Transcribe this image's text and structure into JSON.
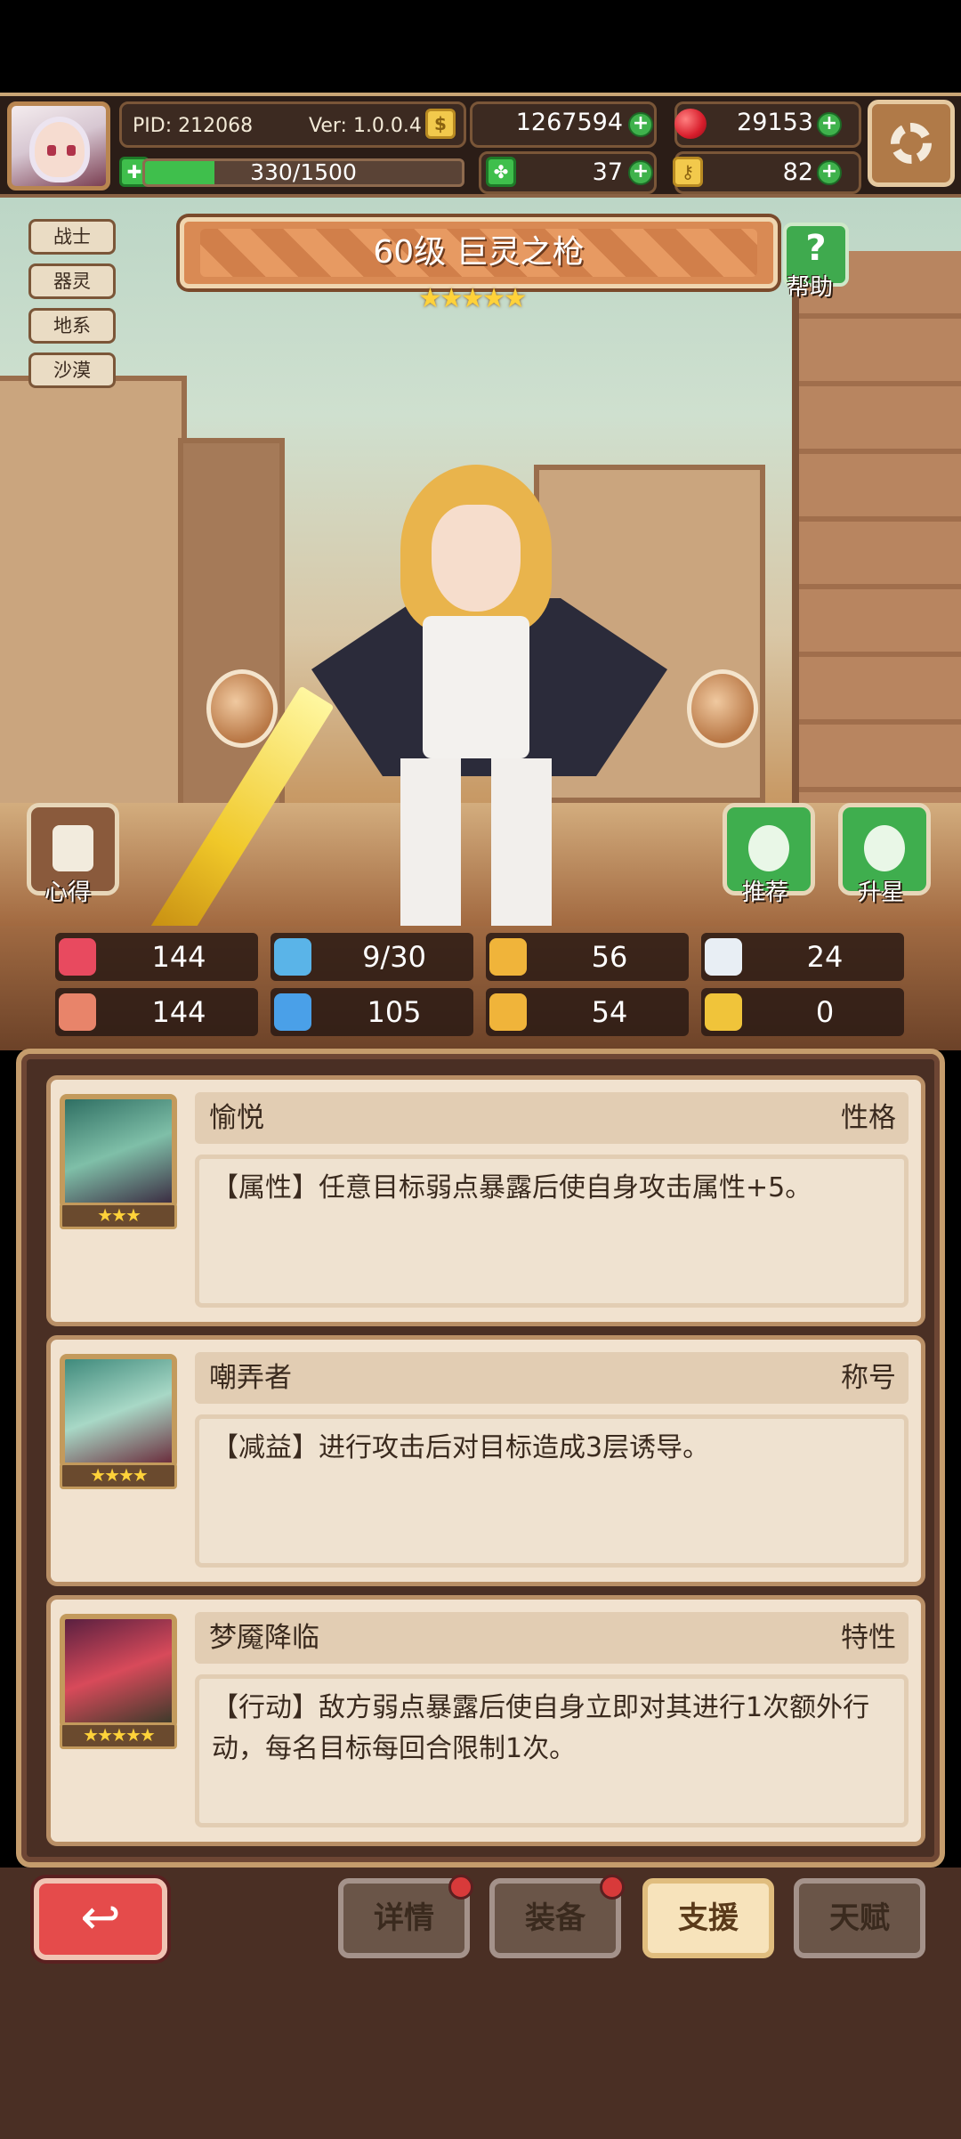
{
  "header": {
    "pid": "PID: 212068",
    "version": "Ver: 1.0.0.4",
    "gold": "1267594",
    "gems": "29153",
    "energy": "330/1500",
    "energy_fraction": 0.22,
    "clover": "37",
    "key": "82"
  },
  "tags": [
    "战士",
    "器灵",
    "地系",
    "沙漠"
  ],
  "hero": {
    "title": "60级  巨灵之枪",
    "stars": "★★★★★",
    "help_label": "帮助",
    "heart_label": "心得",
    "recommend_label": "推荐",
    "upgrade_label": "升星"
  },
  "stats": [
    {
      "icon": "heart-icon",
      "value": "144",
      "color": "#e84a5f"
    },
    {
      "icon": "water-drop-icon",
      "value": "9/30",
      "color": "#5ab4e8"
    },
    {
      "icon": "shield-icon",
      "value": "56",
      "color": "#f0b43a"
    },
    {
      "icon": "wing-icon",
      "value": "24",
      "color": "#e8eef4"
    },
    {
      "icon": "fist-icon",
      "value": "144",
      "color": "#e8846a"
    },
    {
      "icon": "book-icon",
      "value": "105",
      "color": "#4aa0e8"
    },
    {
      "icon": "boot-icon",
      "value": "54",
      "color": "#f0b43a"
    },
    {
      "icon": "horseshoe-icon",
      "value": "0",
      "color": "#f0c43a"
    }
  ],
  "supports": [
    {
      "name": "愉悦",
      "type": "性格",
      "stars": "★★★",
      "desc": "【属性】任意目标弱点暴露后使自身攻击属性+5。"
    },
    {
      "name": "嘲弄者",
      "type": "称号",
      "stars": "★★★★",
      "desc": "【减益】进行攻击后对目标造成3层诱导。"
    },
    {
      "name": "梦魇降临",
      "type": "特性",
      "stars": "★★★★★",
      "desc": "【行动】敌方弱点暴露后使自身立即对其进行1次额外行动，每名目标每回合限制1次。"
    }
  ],
  "nav": {
    "back_icon": "↩",
    "details": "详情",
    "equip": "装备",
    "support": "支援",
    "talent": "天赋"
  }
}
